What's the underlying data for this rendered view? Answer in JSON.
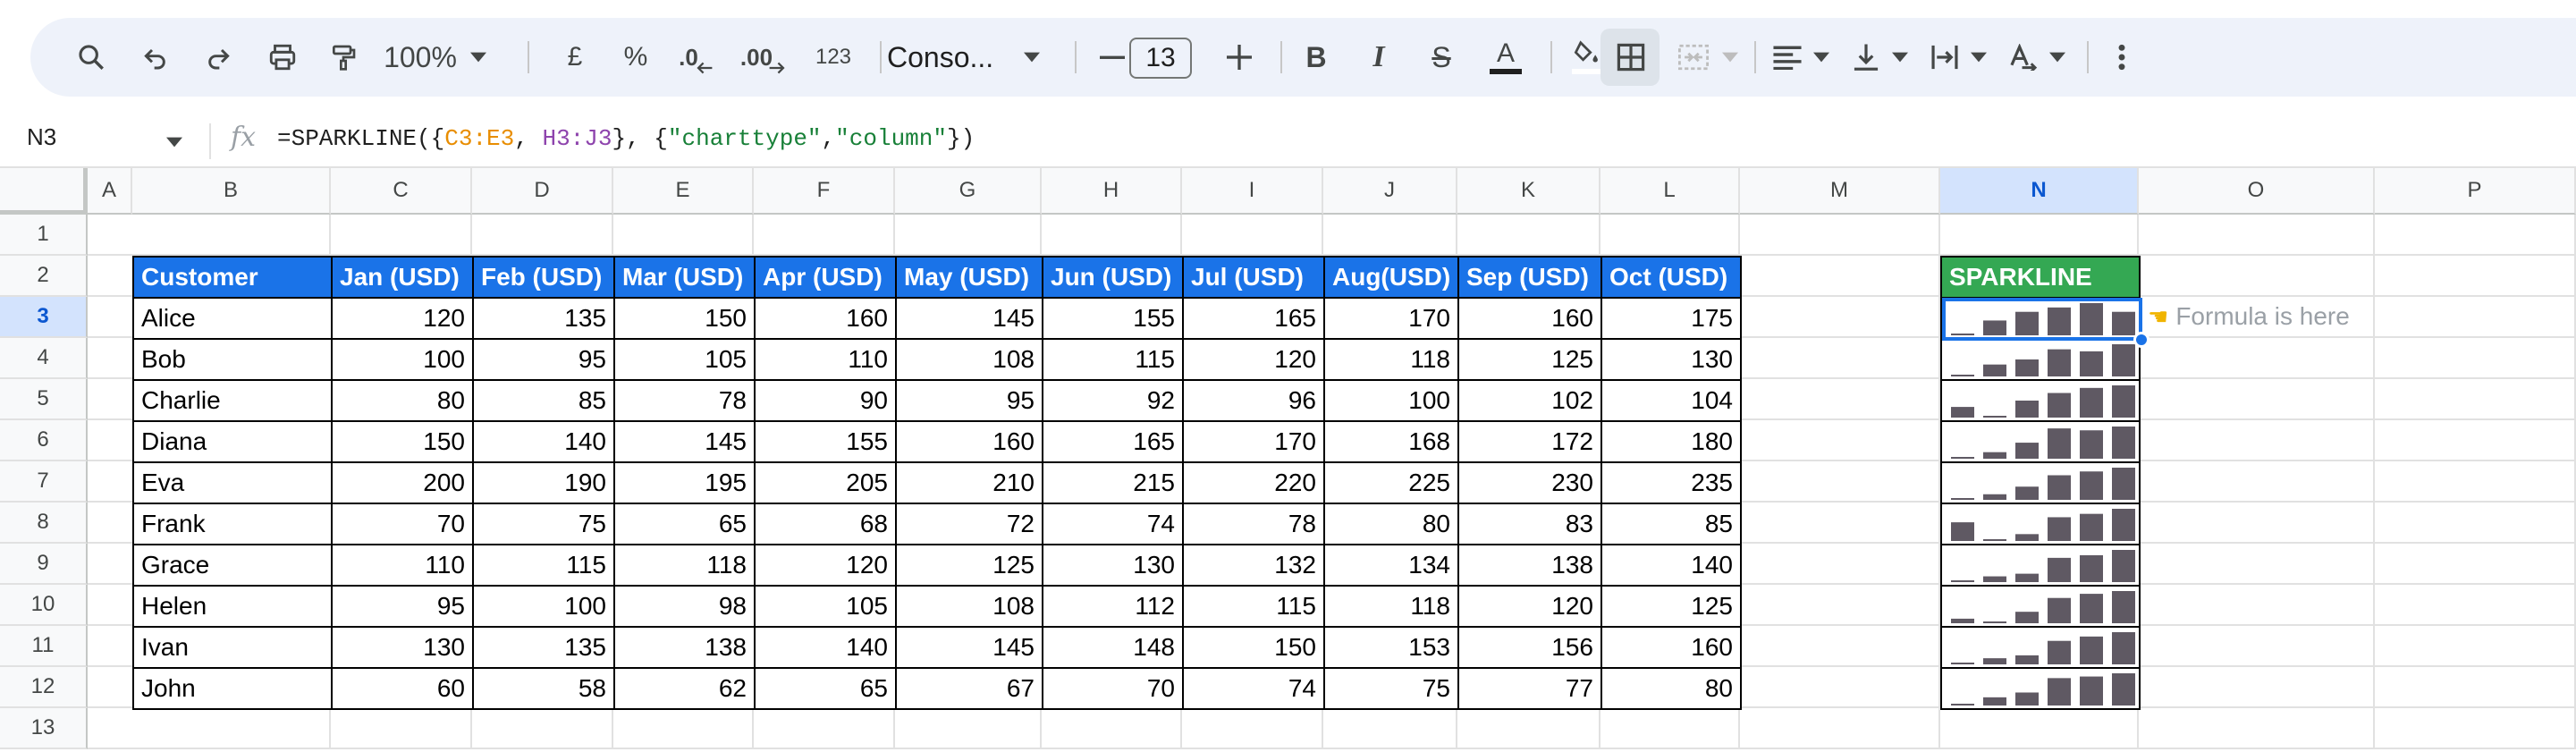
{
  "toolbar": {
    "zoom": "100%",
    "currency": "£",
    "percent": "%",
    "decrease_decimal": ".0",
    "increase_decimal": ".00",
    "number_format": "123",
    "font": "Conso...",
    "font_size": "13"
  },
  "formula_bar": {
    "name_box": "N3",
    "fx": "fx",
    "formula_parts": [
      "=SPARKLINE({",
      "C3:E3",
      ", ",
      "H3:J3",
      "}, {",
      "\"charttype\"",
      ",",
      "\"column\"",
      "})"
    ]
  },
  "columns": [
    "A",
    "B",
    "C",
    "D",
    "E",
    "F",
    "G",
    "H",
    "I",
    "J",
    "K",
    "L",
    "M",
    "N",
    "O",
    "P"
  ],
  "selected_column": "N",
  "rows": [
    "1",
    "2",
    "3",
    "4",
    "5",
    "6",
    "7",
    "8",
    "9",
    "10",
    "11",
    "12",
    "13"
  ],
  "selected_row": "3",
  "table": {
    "headers": [
      "Customer",
      "Jan (USD)",
      "Feb (USD)",
      "Mar (USD)",
      "Apr (USD)",
      "May (USD)",
      "Jun (USD)",
      "Jul (USD)",
      "Aug(USD)",
      "Sep (USD)",
      "Oct (USD)"
    ],
    "data": [
      [
        "Alice",
        "120",
        "135",
        "150",
        "160",
        "145",
        "155",
        "165",
        "170",
        "160",
        "175"
      ],
      [
        "Bob",
        "100",
        "95",
        "105",
        "110",
        "108",
        "115",
        "120",
        "118",
        "125",
        "130"
      ],
      [
        "Charlie",
        "80",
        "85",
        "78",
        "90",
        "95",
        "92",
        "96",
        "100",
        "102",
        "104"
      ],
      [
        "Diana",
        "150",
        "140",
        "145",
        "155",
        "160",
        "165",
        "170",
        "168",
        "172",
        "180"
      ],
      [
        "Eva",
        "200",
        "190",
        "195",
        "205",
        "210",
        "215",
        "220",
        "225",
        "230",
        "235"
      ],
      [
        "Frank",
        "70",
        "75",
        "65",
        "68",
        "72",
        "74",
        "78",
        "80",
        "83",
        "85"
      ],
      [
        "Grace",
        "110",
        "115",
        "118",
        "120",
        "125",
        "130",
        "132",
        "134",
        "138",
        "140"
      ],
      [
        "Helen",
        "95",
        "100",
        "98",
        "105",
        "108",
        "112",
        "115",
        "118",
        "120",
        "125"
      ],
      [
        "Ivan",
        "130",
        "135",
        "138",
        "140",
        "145",
        "148",
        "150",
        "153",
        "156",
        "160"
      ],
      [
        "John",
        "60",
        "58",
        "62",
        "65",
        "67",
        "70",
        "74",
        "75",
        "77",
        "80"
      ]
    ]
  },
  "sparkline": {
    "header": "SPARKLINE",
    "bar_color": "#5f5963",
    "note": "Formula is here",
    "note_icon": "pointing-hand-icon"
  },
  "colors": {
    "header_blue": "#1a73e8",
    "sparkline_green": "#34a853",
    "selection_blue": "#1a73e8"
  }
}
